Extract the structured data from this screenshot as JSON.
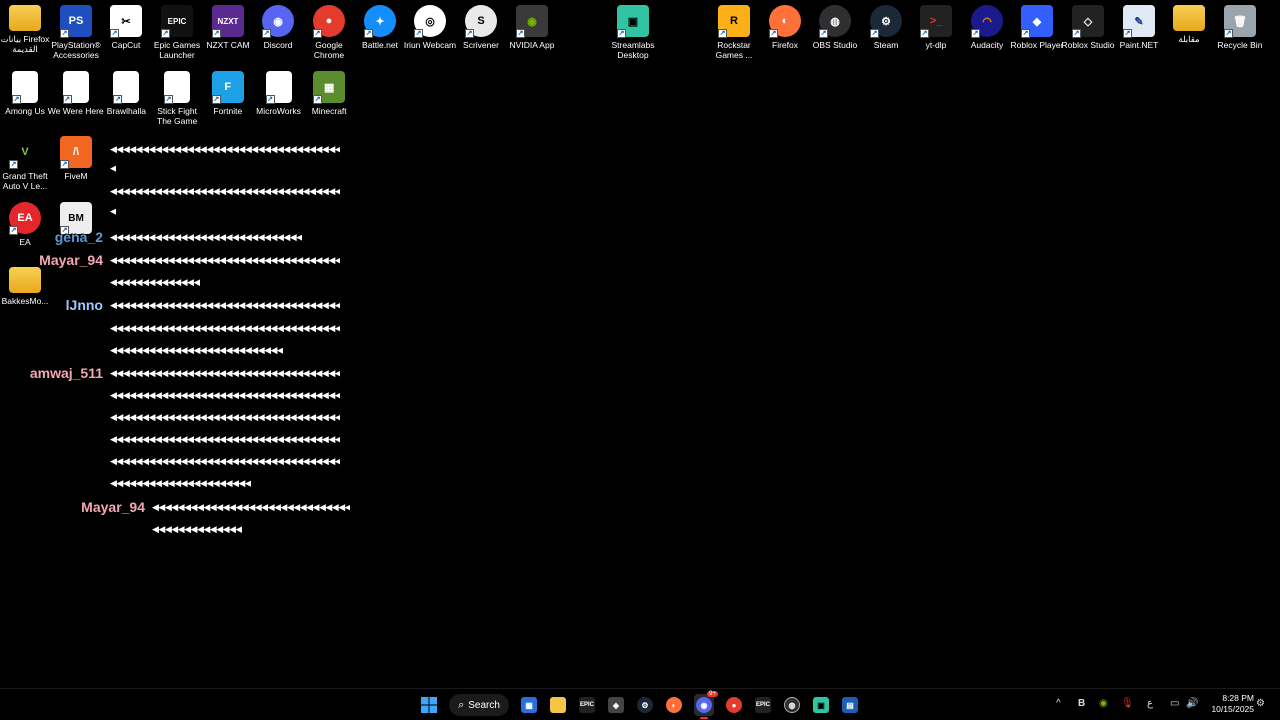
{
  "desktop_icons_top": [
    {
      "label": "بيانات Firefox القديمة",
      "kind": "folder"
    },
    {
      "label": "PlayStation® Accessories",
      "kind": "app",
      "color": "#1f4fbf",
      "glyph": "PS"
    },
    {
      "label": "CapCut",
      "kind": "app",
      "color": "#ffffff",
      "fg": "#000",
      "glyph": "✂"
    },
    {
      "label": "Epic Games Launcher",
      "kind": "app",
      "color": "#111111",
      "glyph": "EPIC"
    },
    {
      "label": "NZXT CAM",
      "kind": "app",
      "color": "#5b2a91",
      "glyph": "NZXT"
    },
    {
      "label": "Discord",
      "kind": "app",
      "color": "#5865f2",
      "glyph": "◉",
      "round": true
    },
    {
      "label": "Google Chrome",
      "kind": "app",
      "color": "#e33b2e",
      "glyph": "●",
      "round": true
    },
    {
      "label": "Battle.net",
      "kind": "app",
      "color": "#148eff",
      "glyph": "✦",
      "round": true
    },
    {
      "label": "Iriun Webcam",
      "kind": "app",
      "color": "#ffffff",
      "fg": "#000",
      "glyph": "◎",
      "round": true
    },
    {
      "label": "Scrivener",
      "kind": "app",
      "color": "#e9e9e9",
      "fg": "#000",
      "glyph": "S",
      "round": true
    },
    {
      "label": "NVIDIA App",
      "kind": "app",
      "color": "#3a3a3a",
      "fg": "#76b900",
      "glyph": "◉"
    },
    {
      "label": "Streamlabs Desktop",
      "kind": "app",
      "color": "#31c3a2",
      "fg": "#000",
      "glyph": "▣"
    },
    {
      "label": "Rockstar Games ...",
      "kind": "app",
      "color": "#fcaf17",
      "fg": "#000",
      "glyph": "R"
    },
    {
      "label": "Firefox",
      "kind": "app",
      "color": "#ff7139",
      "glyph": "◐",
      "round": true
    },
    {
      "label": "OBS Studio",
      "kind": "app",
      "color": "#302e31",
      "glyph": "◍",
      "round": true
    },
    {
      "label": "Steam",
      "kind": "app",
      "color": "#1b2838",
      "glyph": "⚙",
      "round": true
    },
    {
      "label": "yt-dlp",
      "kind": "app",
      "color": "#222222",
      "fg": "#e33",
      "glyph": ">_"
    },
    {
      "label": "Audacity",
      "kind": "app",
      "color": "#1a1a8c",
      "fg": "#f80",
      "glyph": "◠",
      "round": true
    },
    {
      "label": "Roblox Player",
      "kind": "app",
      "color": "#335fff",
      "glyph": "◆"
    },
    {
      "label": "Roblox Studio",
      "kind": "app",
      "color": "#222222",
      "glyph": "◇"
    },
    {
      "label": "Paint.NET",
      "kind": "app",
      "color": "#dfe8f5",
      "fg": "#1a3c8f",
      "glyph": "✎"
    },
    {
      "label": "مقابلة",
      "kind": "folder"
    },
    {
      "label": "Recycle Bin",
      "kind": "app",
      "color": "#9aa4ad",
      "glyph": "🗑"
    }
  ],
  "desktop_icons_row2": [
    {
      "label": "Among Us",
      "kind": "doc"
    },
    {
      "label": "We Were Here",
      "kind": "doc"
    },
    {
      "label": "Brawlhalla",
      "kind": "doc"
    },
    {
      "label": "Stick Fight The Game",
      "kind": "doc"
    },
    {
      "label": "Fortnite",
      "kind": "app",
      "color": "#1ea0e6",
      "glyph": "F"
    },
    {
      "label": "MicroWorks",
      "kind": "doc"
    },
    {
      "label": "Minecraft",
      "kind": "app",
      "color": "#5b8d2f",
      "glyph": "▦"
    }
  ],
  "desktop_icons_col": [
    {
      "label": "Grand Theft Auto V Le...",
      "kind": "app",
      "color": "#000000",
      "fg": "#7ec850",
      "glyph": "V"
    },
    {
      "label": "FiveM",
      "kind": "app",
      "color": "#f26822",
      "glyph": "/\\"
    },
    {
      "label": "EA",
      "kind": "app",
      "color": "#e4272b",
      "glyph": "EA",
      "round": true
    },
    {
      "label": "BakkesMo...",
      "kind": "folder"
    }
  ],
  "bm_icon": {
    "glyph": "BM"
  },
  "chat": {
    "garbled": "◀◀◀◀◀◀◀◀◀◀◀◀◀◀◀◀◀◀◀◀◀◀◀◀◀◀◀◀◀◀◀◀◀◀◀◀",
    "names": [
      {
        "text": "gena_2",
        "color": "#5b9bd5"
      },
      {
        "text": "Mayar_94",
        "color": "#f4a6b7"
      },
      {
        "text": "lJnno",
        "color": "#9cc7ff"
      },
      {
        "text": "amwaj_511",
        "color": "#f4a6b7"
      },
      {
        "text": "Mayar_94",
        "color": "#f4a6b7"
      }
    ]
  },
  "taskbar": {
    "search_label": "Search",
    "apps": [
      "start",
      "search",
      "store",
      "explorer",
      "epic",
      "unity",
      "steam",
      "firefox",
      "discord",
      "chrome",
      "epic2",
      "obs",
      "streamlabs",
      "remote"
    ],
    "discord_badge": "9+",
    "tray": {
      "chevron": "^",
      "lang": "ع"
    },
    "time": "8:28 PM",
    "date": "10/15/2025"
  }
}
